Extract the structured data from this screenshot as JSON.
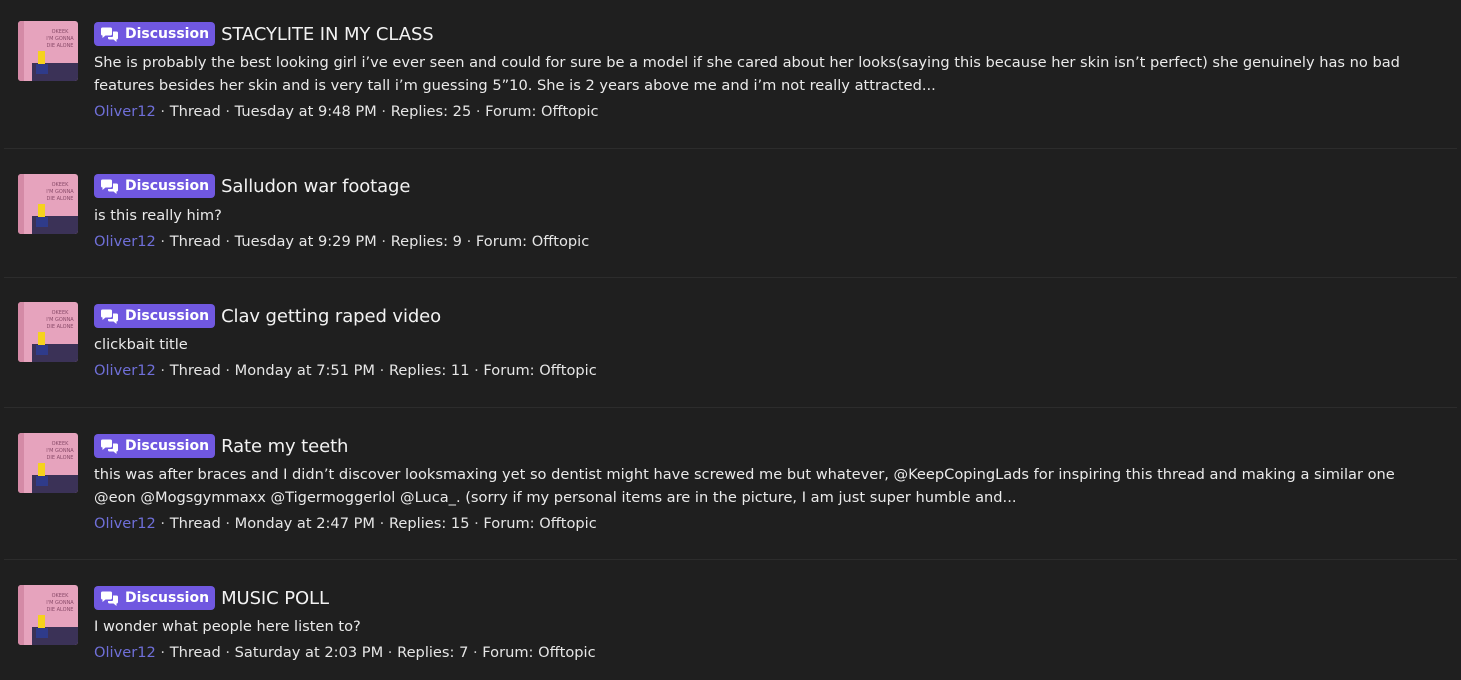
{
  "search_results": [
    {
      "prefix": "Discussion",
      "title": "STACYLITE IN MY CLASS",
      "snippet": "She is probably the best looking girl i’ve ever seen and could for sure be a model if she cared about her looks(saying this because her skin isn’t perfect) she genuinely has no bad features besides her skin and is very tall i’m guessing 5”10. She is 2 years above me and i’m not really attracted...",
      "author": "Oliver12",
      "type": "Thread",
      "date": "Tuesday at 9:48 PM",
      "replies": "Replies: 25",
      "forum": "Forum: Offtopic"
    },
    {
      "prefix": "Discussion",
      "title": "Salludon war footage",
      "snippet": "is this really him?",
      "author": "Oliver12",
      "type": "Thread",
      "date": "Tuesday at 9:29 PM",
      "replies": "Replies: 9",
      "forum": "Forum: Offtopic"
    },
    {
      "prefix": "Discussion",
      "title": "Clav getting raped video",
      "snippet": "clickbait title",
      "author": "Oliver12",
      "type": "Thread",
      "date": "Monday at 7:51 PM",
      "replies": "Replies: 11",
      "forum": "Forum: Offtopic"
    },
    {
      "prefix": "Discussion",
      "title": "Rate my teeth",
      "snippet": "this was after braces and I didn’t discover looksmaxing yet so dentist might have screwed me but whatever, @KeepCopingLads for inspiring this thread and making a similar one @eon @Mogsgymmaxx @Tigermoggerlol @Luca_. (sorry if my personal items are in the picture, I am just super humble and...",
      "author": "Oliver12",
      "type": "Thread",
      "date": "Monday at 2:47 PM",
      "replies": "Replies: 15",
      "forum": "Forum: Offtopic"
    },
    {
      "prefix": "Discussion",
      "title": "MUSIC POLL",
      "snippet": "I wonder what people here listen to?",
      "author": "Oliver12",
      "type": "Thread",
      "date": "Saturday at 2:03 PM",
      "replies": "Replies: 7",
      "forum": "Forum: Offtopic"
    }
  ],
  "separator": " · ",
  "icons": {
    "badge_icon": "chat-bubbles-icon",
    "avatar": "user-avatar"
  },
  "colors": {
    "background": "#1f1f1f",
    "badge": "#7058e0",
    "author_link": "#6f6fd8",
    "avatar_bg": "#e8a0b8"
  }
}
